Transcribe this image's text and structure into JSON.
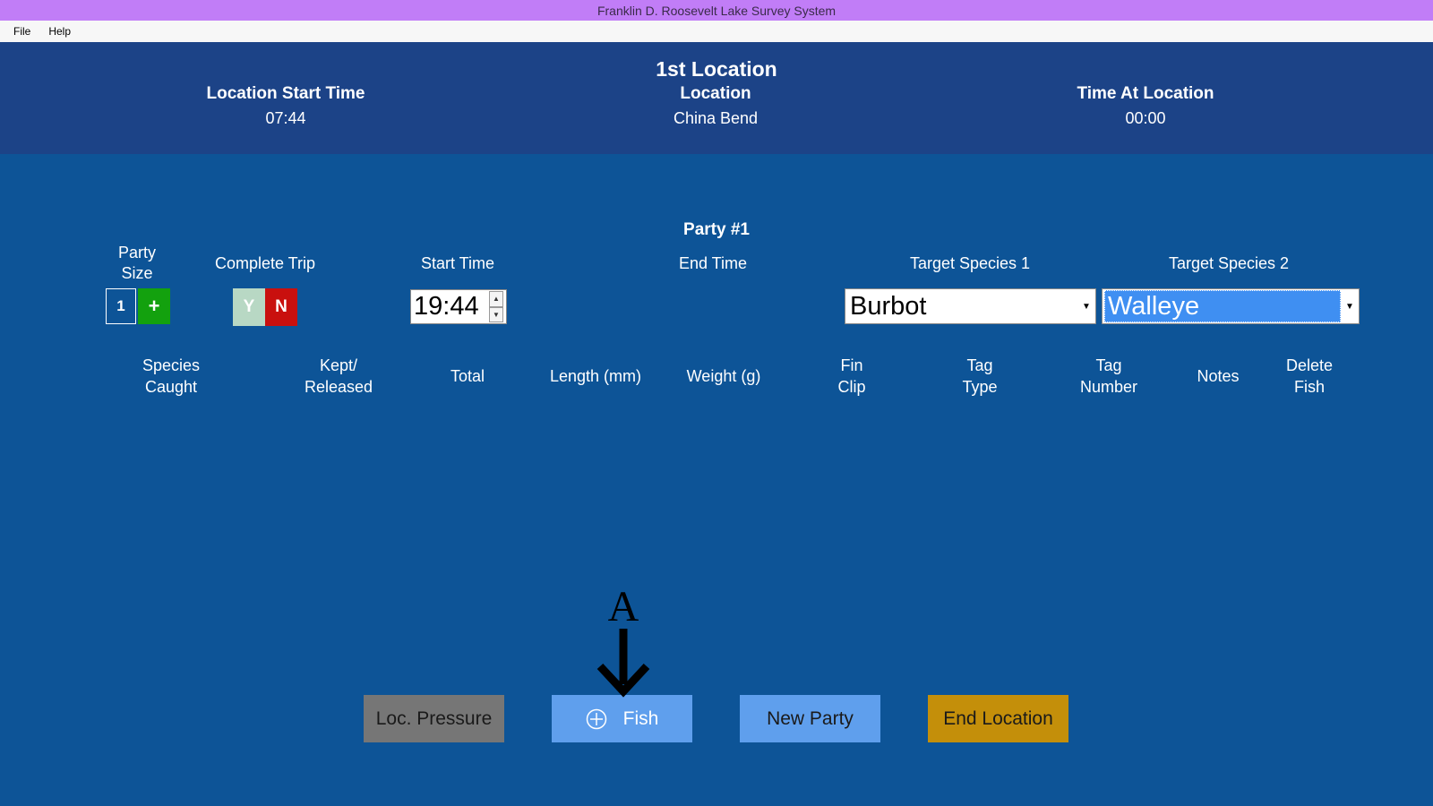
{
  "window": {
    "title": "Franklin D. Roosevelt Lake Survey System"
  },
  "menu": {
    "items": [
      "File",
      "Help"
    ]
  },
  "header": {
    "title": "1st Location",
    "start_time_label": "Location Start Time",
    "start_time_value": "07:44",
    "location_label": "Location",
    "location_value": "China Bend",
    "time_at_label": "Time At Location",
    "time_at_value": "00:00"
  },
  "party": {
    "title": "Party #1",
    "party_size_label": "Party\nSize",
    "party_size_value": "1",
    "party_size_plus": "+",
    "complete_trip_label": "Complete Trip",
    "yes_label": "Y",
    "no_label": "N",
    "start_time_label": "Start Time",
    "start_time_value": "19:44",
    "end_time_label": "End Time",
    "target1_label": "Target Species 1",
    "target1_value": "Burbot",
    "target2_label": "Target Species 2",
    "target2_value": "Walleye"
  },
  "columns": [
    "Species\nCaught",
    "Kept/\nReleased",
    "Total",
    "Length (mm)",
    "Weight (g)",
    "Fin\nClip",
    "Tag\nType",
    "Tag\nNumber",
    "Notes",
    "Delete\nFish"
  ],
  "buttons": {
    "loc_pressure": "Loc. Pressure",
    "fish": "Fish",
    "new_party": "New Party",
    "end_location": "End Location"
  },
  "annotation": {
    "label": "A"
  },
  "colors": {
    "background": "#0d5497",
    "header": "#1c4387",
    "titlebar": "#c17df7",
    "plus_green": "#13a10e",
    "no_red": "#c9100e",
    "yes_pale": "#b8d8c4",
    "button_blue": "#5f9fed",
    "button_gray": "#767676",
    "button_gold": "#c48f0a"
  }
}
